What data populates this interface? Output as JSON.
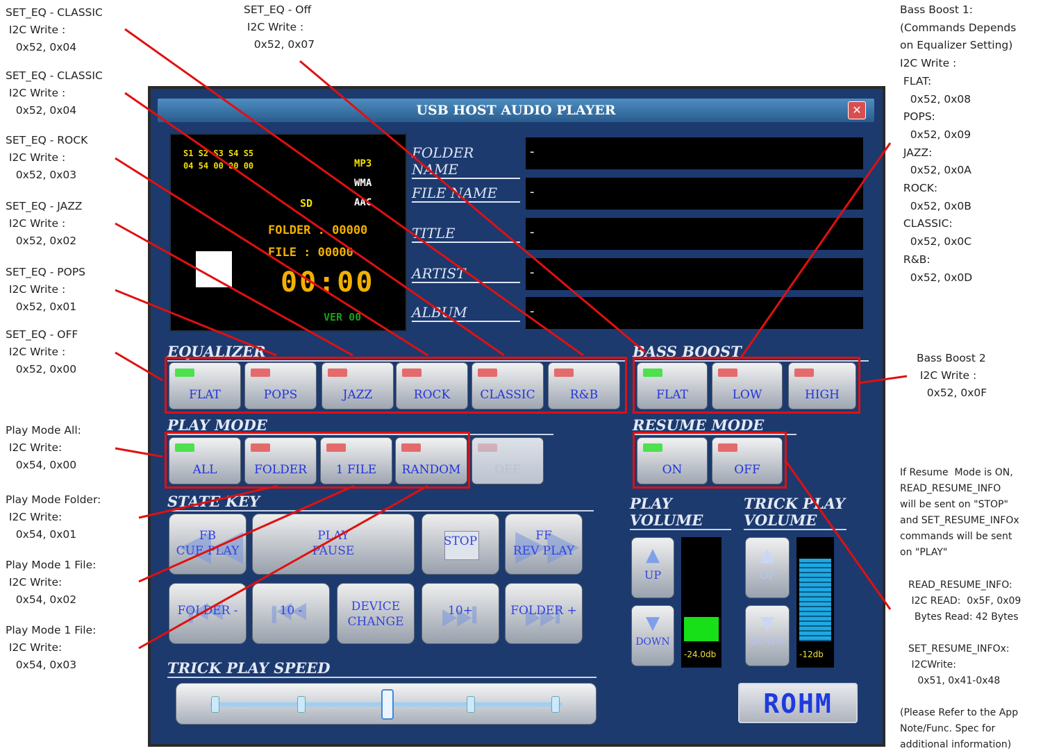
{
  "annotations": {
    "classic_top": "SET_EQ - CLASSIC\n I2C Write :\n   0x52, 0x04",
    "eq_off_top": "SET_EQ - Off\n I2C Write :\n   0x52, 0x07",
    "classic_2": "SET_EQ - CLASSIC\n I2C Write :\n   0x52, 0x04",
    "rock": "SET_EQ - ROCK\n I2C Write :\n   0x52, 0x03",
    "jazz": "SET_EQ - JAZZ\n I2C Write :\n   0x52, 0x02",
    "pops": "SET_EQ - POPS\n I2C Write :\n   0x52, 0x01",
    "off": "SET_EQ - OFF\n I2C Write :\n   0x52, 0x00",
    "play_all": "Play Mode All:\n I2C Write:\n   0x54, 0x00",
    "play_folder": "Play Mode Folder:\n I2C Write:\n   0x54, 0x01",
    "play_1file_a": "Play Mode 1 File:\n I2C Write:\n   0x54, 0x02",
    "play_1file_b": "Play Mode 1 File:\n I2C Write:\n   0x54, 0x03",
    "bass1": "Bass Boost 1:\n(Commands Depends\non Equalizer Setting)\nI2C Write :\n FLAT:\n   0x52, 0x08\n POPS:\n   0x52, 0x09\n JAZZ:\n   0x52, 0x0A\n ROCK:\n   0x52, 0x0B\n CLASSIC:\n   0x52, 0x0C\n R&B:\n   0x52, 0x0D",
    "bass2": "Bass Boost 2\n I2C Write :\n   0x52, 0x0F",
    "resume": "If Resume  Mode is ON,\nREAD_RESUME_INFO\nwill be sent on \"STOP\"\nand SET_RESUME_INFOx\ncommands will be sent\non \"PLAY\"",
    "read_resume": "READ_RESUME_INFO:\n I2C READ:  0x5F, 0x09\n  Bytes Read: 42 Bytes",
    "set_resume": "SET_RESUME_INFOx:\n I2CWrite:\n   0x51, 0x41-0x48",
    "refer": "(Please Refer to the App\nNote/Func. Spec for\nadditional information)"
  },
  "window": {
    "title": "USB HOST AUDIO PLAYER",
    "close": "✕"
  },
  "display": {
    "s_row": "S1 S2 S3 S4 S5",
    "n_row": "04 54 00 00 00",
    "mp3": "MP3",
    "wma": "WMA",
    "aac": "AAC",
    "sd": "SD",
    "folder": "FOLDER  :  00000",
    "file": "FILE      :  00000",
    "time": "00:00",
    "ver": "VER 00"
  },
  "info": {
    "folder_label": "FOLDER NAME",
    "file_label": "FILE NAME",
    "title_label": "TITLE",
    "artist_label": "ARTIST",
    "album_label": "ALBUM",
    "folder_value": "-",
    "file_value": "-",
    "title_value": "-",
    "artist_value": "-",
    "album_value": "-"
  },
  "sections": {
    "equalizer": "EQUALIZER",
    "bass": "BASS BOOST",
    "play_mode": "PLAY MODE",
    "resume": "RESUME MODE",
    "state_key": "STATE KEY",
    "play_vol": "PLAY\nVOLUME",
    "trick_vol": "TRICK PLAY\nVOLUME",
    "trick_speed": "TRICK PLAY SPEED"
  },
  "equalizer": [
    "FLAT",
    "POPS",
    "JAZZ",
    "ROCK",
    "CLASSIC",
    "R&B"
  ],
  "bass": [
    "FLAT",
    "LOW",
    "HIGH"
  ],
  "play_mode": [
    "ALL",
    "FOLDER",
    "1 FILE",
    "RANDOM",
    "OFF"
  ],
  "resume_mode": [
    "ON",
    "OFF"
  ],
  "state_keys": {
    "fb": "FB\nCUE PLAY",
    "play": "PLAY\nPAUSE",
    "stop": "STOP",
    "ff": "FF\nREV PLAY",
    "folder_minus": "FOLDER -",
    "ten_minus": "10 -",
    "device": "DEVICE\nCHANGE",
    "ten_plus": "10+",
    "folder_plus": "FOLDER +"
  },
  "volume": {
    "up": "UP",
    "down": "DOWN",
    "play_db": "-24.0db",
    "trick_db": "-12db",
    "play_level": 0.25,
    "trick_level": 0.85
  },
  "trick_speed_position": 0.5,
  "logo": "ROHM",
  "colors": {
    "window_bg": "#1c3a6e",
    "annotation_red": "#e01010",
    "led_on": "#4ee04e",
    "led_off": "#e46b6b"
  }
}
